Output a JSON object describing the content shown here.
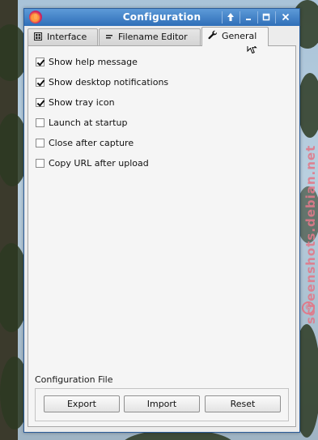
{
  "window": {
    "title": "Configuration",
    "controls": {
      "keep_above": "🠕",
      "minimize": "–",
      "maximize": "▫",
      "close": "✕"
    }
  },
  "tabs": [
    {
      "label": "Interface",
      "icon": "interface-icon",
      "active": false
    },
    {
      "label": "Filename Editor",
      "icon": "editor-icon",
      "active": false
    },
    {
      "label": "General",
      "icon": "wrench-icon",
      "active": true
    }
  ],
  "general": {
    "options": [
      {
        "label": "Show help message",
        "checked": true
      },
      {
        "label": "Show desktop notifications",
        "checked": true
      },
      {
        "label": "Show tray icon",
        "checked": true
      },
      {
        "label": "Launch at startup",
        "checked": false
      },
      {
        "label": "Close after capture",
        "checked": false
      },
      {
        "label": "Copy URL after upload",
        "checked": false
      }
    ],
    "config_file": {
      "label": "Configuration File",
      "export_label": "Export",
      "import_label": "Import",
      "reset_label": "Reset"
    }
  },
  "watermark": {
    "text": "screenshots.debian.net"
  },
  "colors": {
    "titlebar": "#2f6fb8",
    "accent": "#5d9ad8"
  }
}
